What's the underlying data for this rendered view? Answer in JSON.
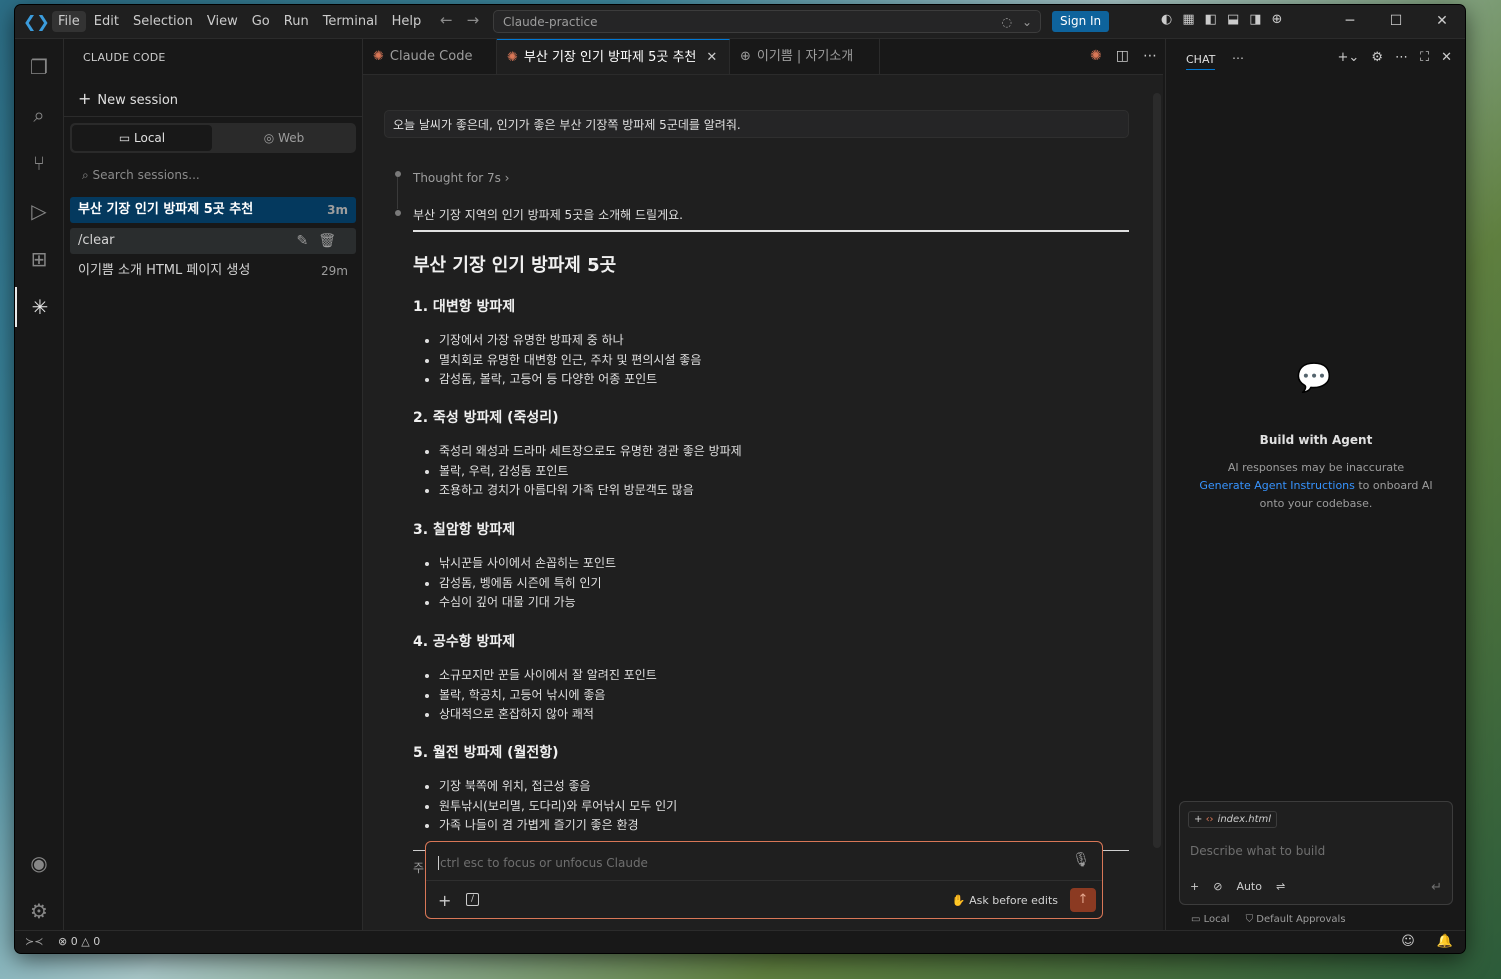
{
  "menu": [
    "File",
    "Edit",
    "Selection",
    "View",
    "Go",
    "Run",
    "Terminal",
    "Help"
  ],
  "command_center": "Claude-practice",
  "signin": "Sign In",
  "sidebar": {
    "title": "CLAUDE CODE",
    "new_session": "New session",
    "seg_local": "Local",
    "seg_web": "Web",
    "search_placeholder": "Search sessions...",
    "sessions": [
      {
        "label": "부산 기장 인기 방파제 5곳 추천",
        "age": "3m"
      },
      {
        "label": "/clear",
        "age": ""
      },
      {
        "label": "이기쁨 소개 HTML 페이지 생성",
        "age": "29m"
      }
    ]
  },
  "tabs": [
    {
      "label": "Claude Code"
    },
    {
      "label": "부산 기장 인기 방파제 5곳 추천"
    },
    {
      "label": "이기쁨 | 자기소개"
    }
  ],
  "conversation": {
    "user_message": "오늘 날씨가 좋은데, 인기가 좋은 부산 기장쪽 방파제 5군데를 알려줘.",
    "thought": "Thought for 7s",
    "intro": "부산 기장 지역의 인기 방파제 5곳을 소개해 드릴게요.",
    "heading": "부산 기장 인기 방파제 5곳",
    "sections": [
      {
        "title": "1. 대변항 방파제",
        "items": [
          "기장에서 가장 유명한 방파제 중 하나",
          "멸치회로 유명한 대변항 인근, 주차 및 편의시설 좋음",
          "감성돔, 볼락, 고등어 등 다양한 어종 포인트"
        ]
      },
      {
        "title": "2. 죽성 방파제 (죽성리)",
        "items": [
          "죽성리 왜성과 드라마 세트장으로도 유명한 경관 좋은 방파제",
          "볼락, 우럭, 감성돔 포인트",
          "조용하고 경치가 아름다워 가족 단위 방문객도 많음"
        ]
      },
      {
        "title": "3. 칠암항 방파제",
        "items": [
          "낚시꾼들 사이에서 손꼽히는 포인트",
          "감성돔, 벵에돔 시즌에 특히 인기",
          "수심이 깊어 대물 기대 가능"
        ]
      },
      {
        "title": "4. 공수항 방파제",
        "items": [
          "소규모지만 꾼들 사이에서 잘 알려진 포인트",
          "볼락, 학공치, 고등어 낚시에 좋음",
          "상대적으로 혼잡하지 않아 쾌적"
        ]
      },
      {
        "title": "5. 월전 방파제 (월전항)",
        "items": [
          "기장 북쪽에 위치, 접근성 좋음",
          "원투낚시(보리멸, 도다리)와 루어낚시 모두 인기",
          "가족 나들이 겸 가볍게 즐기기 좋은 환경"
        ]
      }
    ],
    "trailing_stub": "주"
  },
  "prompt": {
    "placeholder": "ctrl esc to focus or unfocus Claude",
    "ask_mode": "Ask before edits"
  },
  "chat": {
    "tab": "CHAT",
    "title": "Build with Agent",
    "line1": "AI responses may be inaccurate",
    "link": "Generate Agent Instructions",
    "line2": " to onboard AI onto your codebase.",
    "file_chip": "index.html",
    "placeholder": "Describe what to build",
    "mode": "Auto",
    "foot_local": "Local",
    "foot_approvals": "Default Approvals"
  },
  "status": {
    "errors": "0",
    "warnings": "0"
  },
  "colors": {
    "accent": "#0078d4",
    "claude": "#d97757",
    "signin": "#0e639c"
  }
}
